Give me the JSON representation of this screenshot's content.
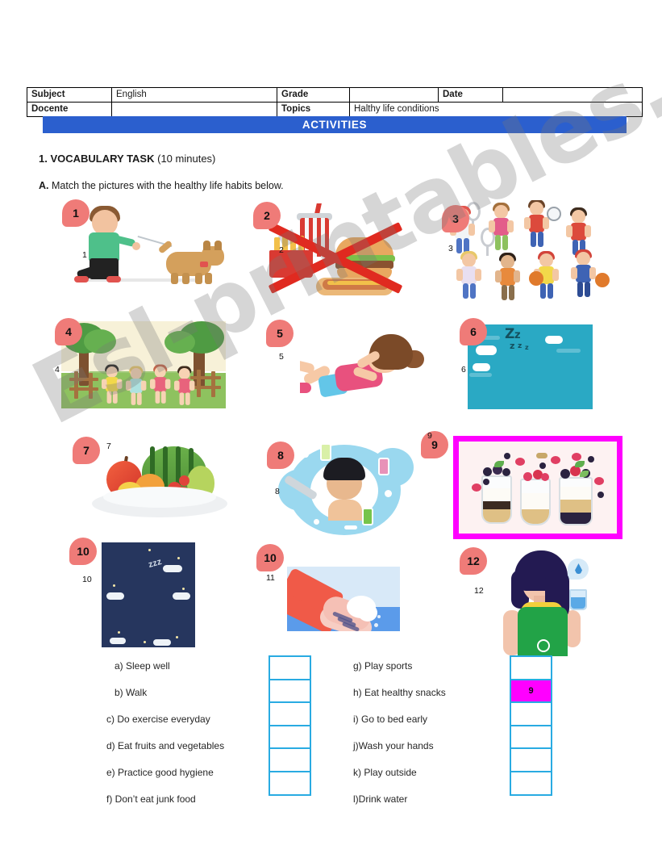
{
  "watermark": "Esl-printables.com",
  "info_table": {
    "rows": [
      [
        {
          "label": "Subject",
          "bold": true
        },
        {
          "label": "English",
          "bold": false
        },
        {
          "label": "Grade",
          "bold": true
        },
        {
          "label": "",
          "bold": false
        },
        {
          "label": "Date",
          "bold": true
        },
        {
          "label": "",
          "bold": false
        }
      ],
      [
        {
          "label": "Docente",
          "bold": true
        },
        {
          "label": "",
          "bold": false
        },
        {
          "label": "Topics",
          "bold": true
        },
        {
          "label": "Halthy life conditions",
          "bold": false
        },
        {
          "label": "",
          "bold": false
        },
        {
          "label": "",
          "bold": false
        }
      ]
    ]
  },
  "activities_bar": {
    "title": "ACTIVITIES"
  },
  "task": {
    "number_title": "1. VOCABULARY TASK",
    "duration": "(10 minutes)",
    "instruction_letter": "A.",
    "instruction_text": "Match the pictures with the healthy life habits below."
  },
  "pictures": [
    {
      "badge": "1",
      "caption_number": "1",
      "alt": "boy-walking-dog"
    },
    {
      "badge": "2",
      "caption_number": "2",
      "alt": "junk-food-crossed-out"
    },
    {
      "badge": "3",
      "caption_number": "3",
      "alt": "kids-playing-sports"
    },
    {
      "badge": "4",
      "caption_number": "4",
      "alt": "kids-playing-outside"
    },
    {
      "badge": "5",
      "caption_number": "5",
      "alt": "girl-doing-sit-ups"
    },
    {
      "badge": "6",
      "caption_number": "6",
      "alt": "girl-sleeping-well"
    },
    {
      "badge": "7",
      "caption_number": "7",
      "alt": "plate-of-fruits"
    },
    {
      "badge": "8",
      "caption_number": "8",
      "alt": "boy-showering-hygiene"
    },
    {
      "badge": "9",
      "caption_number": "9",
      "alt": "healthy-snack-parfaits",
      "selected": true
    },
    {
      "badge": "10",
      "caption_number": "10",
      "alt": "child-sleeping-at-night"
    },
    {
      "badge": "10",
      "caption_number": "11",
      "alt": "washing-hands"
    },
    {
      "badge": "12",
      "caption_number": "12",
      "alt": "girl-drinking-water"
    }
  ],
  "answers": {
    "left_column": [
      "a) Sleep well",
      "b) Walk",
      "c) Do exercise everyday",
      "d) Eat fruits and vegetables",
      "e) Practice good hygiene",
      "f) Don’t eat junk food"
    ],
    "right_column": [
      "g) Play sports",
      "h) Eat healthy snacks",
      "i) Go to bed early",
      "j)Wash your hands",
      "k) Play outside",
      "l)Drink water"
    ],
    "left_boxes": [
      "",
      "",
      "",
      "",
      "",
      ""
    ],
    "right_boxes": [
      "",
      "9",
      "",
      "",
      "",
      ""
    ],
    "right_boxes_filled": [
      false,
      true,
      false,
      false,
      false,
      false
    ]
  },
  "colors": {
    "activities_bar": "#2b5fce",
    "badge": "#ef7b78",
    "box_border": "#29abe2",
    "selected_fill": "#ff00ff",
    "selection_frame": "#ff00ff"
  }
}
